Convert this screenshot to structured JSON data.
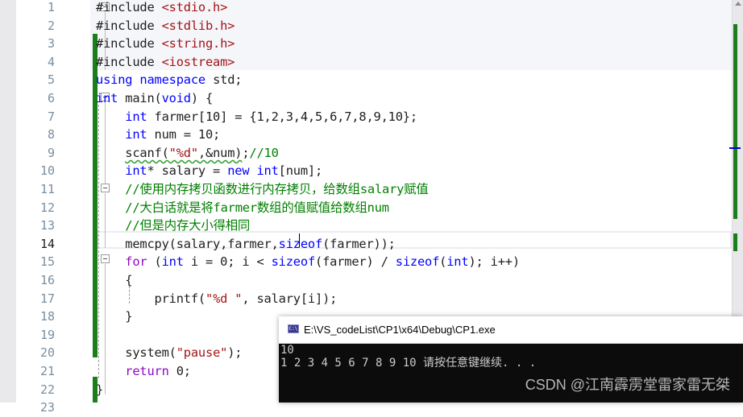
{
  "editor": {
    "current_line": 14,
    "lines": [
      {
        "n": "1",
        "indent": "",
        "tokens": [
          {
            "t": "#include ",
            "c": ""
          },
          {
            "t": "<stdio.h>",
            "c": "str"
          }
        ]
      },
      {
        "n": "2",
        "indent": "",
        "tokens": [
          {
            "t": "#include ",
            "c": ""
          },
          {
            "t": "<stdlib.h>",
            "c": "str"
          }
        ]
      },
      {
        "n": "3",
        "indent": "",
        "tokens": [
          {
            "t": "#include ",
            "c": ""
          },
          {
            "t": "<string.h>",
            "c": "str"
          }
        ]
      },
      {
        "n": "4",
        "indent": "",
        "tokens": [
          {
            "t": "#include ",
            "c": ""
          },
          {
            "t": "<iostream>",
            "c": "str"
          }
        ]
      },
      {
        "n": "5",
        "indent": "",
        "tokens": [
          {
            "t": "using namespace ",
            "c": "kw"
          },
          {
            "t": "std;",
            "c": ""
          }
        ]
      },
      {
        "n": "6",
        "indent": "",
        "tokens": [
          {
            "t": "int ",
            "c": "kw"
          },
          {
            "t": "main(",
            "c": ""
          },
          {
            "t": "void",
            "c": "kw"
          },
          {
            "t": ") {",
            "c": ""
          }
        ]
      },
      {
        "n": "7",
        "indent": "    ",
        "tokens": [
          {
            "t": "int ",
            "c": "kw"
          },
          {
            "t": "farmer[10] = {1,2,3,4,5,6,7,8,9,10};",
            "c": ""
          }
        ]
      },
      {
        "n": "8",
        "indent": "    ",
        "tokens": [
          {
            "t": "int ",
            "c": "kw"
          },
          {
            "t": "num = 10;",
            "c": ""
          }
        ]
      },
      {
        "n": "9",
        "indent": "    ",
        "tokens": [
          {
            "t": "scanf(",
            "c": "sq"
          },
          {
            "t": "\"%d\"",
            "c": "sqstr"
          },
          {
            "t": ",&num)",
            "c": "sq"
          },
          {
            "t": ";",
            "c": ""
          },
          {
            "t": "//10",
            "c": "cmt"
          }
        ]
      },
      {
        "n": "10",
        "indent": "    ",
        "tokens": [
          {
            "t": "int",
            "c": "kw"
          },
          {
            "t": "* salary = ",
            "c": ""
          },
          {
            "t": "new int",
            "c": "kw"
          },
          {
            "t": "[num];",
            "c": ""
          }
        ]
      },
      {
        "n": "11",
        "indent": "    ",
        "tokens": [
          {
            "t": "//使用内存拷贝函数进行内存拷贝，给数组salary赋值",
            "c": "cmt"
          }
        ]
      },
      {
        "n": "12",
        "indent": "    ",
        "tokens": [
          {
            "t": "//大白话就是将farmer数组的值赋值给数组num",
            "c": "cmt"
          }
        ]
      },
      {
        "n": "13",
        "indent": "    ",
        "tokens": [
          {
            "t": "//但是内存大小得相同",
            "c": "cmt"
          }
        ]
      },
      {
        "n": "14",
        "indent": "    ",
        "tokens": [
          {
            "t": "memcpy(salary,farmer,",
            "c": ""
          },
          {
            "t": "sizeof",
            "c": "kw"
          },
          {
            "t": "(farmer));",
            "c": ""
          }
        ]
      },
      {
        "n": "15",
        "indent": "    ",
        "tokens": [
          {
            "t": "for ",
            "c": "flow"
          },
          {
            "t": "(",
            "c": ""
          },
          {
            "t": "int ",
            "c": "kw"
          },
          {
            "t": "i = 0; i < ",
            "c": ""
          },
          {
            "t": "sizeof",
            "c": "kw"
          },
          {
            "t": "(farmer) / ",
            "c": ""
          },
          {
            "t": "sizeof",
            "c": "kw"
          },
          {
            "t": "(",
            "c": ""
          },
          {
            "t": "int",
            "c": "kw"
          },
          {
            "t": "); i++)",
            "c": ""
          }
        ]
      },
      {
        "n": "16",
        "indent": "    ",
        "tokens": [
          {
            "t": "{",
            "c": ""
          }
        ]
      },
      {
        "n": "17",
        "indent": "        ",
        "tokens": [
          {
            "t": "printf(",
            "c": ""
          },
          {
            "t": "\"%d \"",
            "c": "str"
          },
          {
            "t": ", salary[i]);",
            "c": ""
          }
        ]
      },
      {
        "n": "18",
        "indent": "    ",
        "tokens": [
          {
            "t": "}",
            "c": ""
          }
        ]
      },
      {
        "n": "19",
        "indent": "",
        "tokens": []
      },
      {
        "n": "20",
        "indent": "    ",
        "tokens": [
          {
            "t": "system(",
            "c": ""
          },
          {
            "t": "\"pause\"",
            "c": "str"
          },
          {
            "t": ");",
            "c": ""
          }
        ]
      },
      {
        "n": "21",
        "indent": "    ",
        "tokens": [
          {
            "t": "return ",
            "c": "flow"
          },
          {
            "t": "0;",
            "c": ""
          }
        ]
      },
      {
        "n": "22",
        "indent": "",
        "tokens": [
          {
            "t": "}",
            "c": ""
          }
        ]
      },
      {
        "n": "23",
        "indent": "",
        "tokens": []
      }
    ]
  },
  "console": {
    "title": "E:\\VS_codeList\\CP1\\x64\\Debug\\CP1.exe",
    "icon": "console-app-icon",
    "output_lines": [
      "10",
      "1 2 3 4 5 6 7 8 9 10 请按任意键继续. . ."
    ]
  },
  "watermark": "CSDN @江南霹雳堂雷家雷无桀",
  "colors": {
    "keyword": "#0000ff",
    "string": "#a31515",
    "comment": "#008000",
    "control_flow": "#8f08c4",
    "change_bar": "#1a7f1a"
  }
}
